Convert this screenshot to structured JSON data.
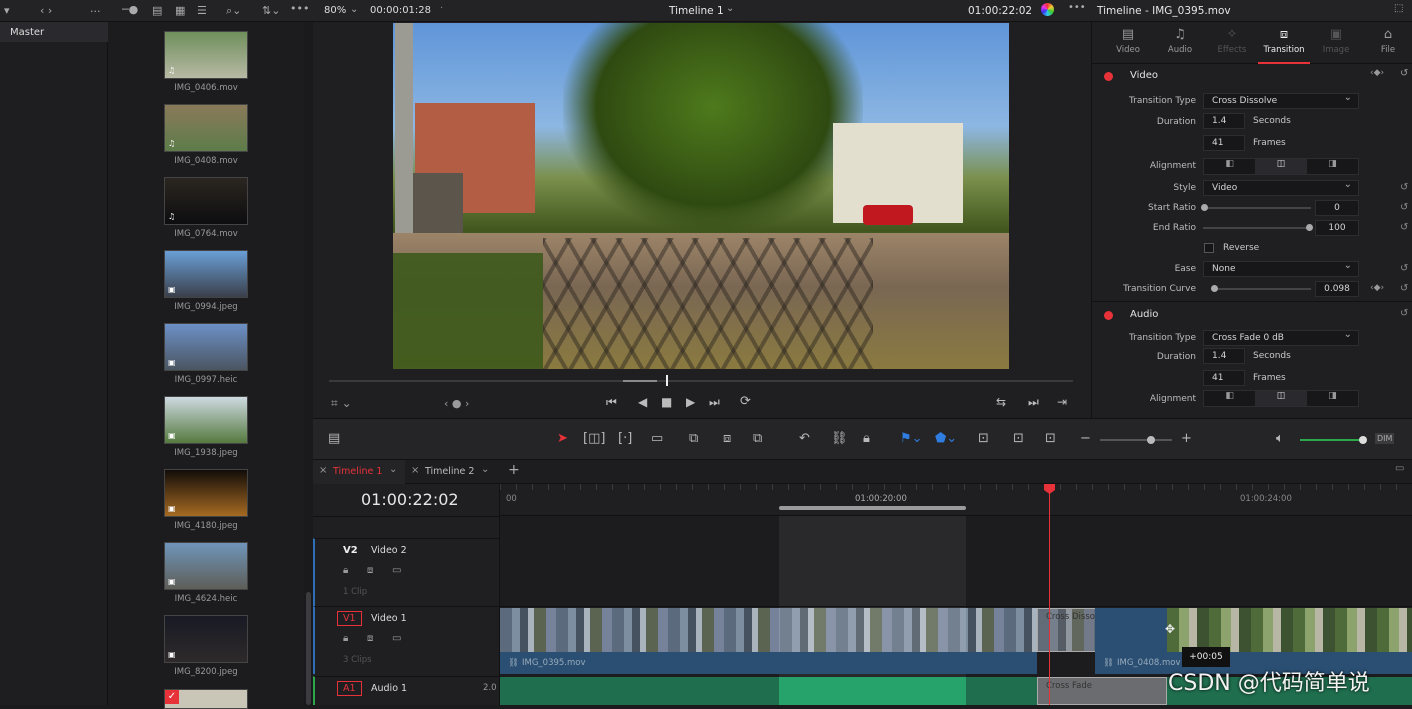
{
  "topbar": {
    "zoom": "80%",
    "zoom_timecode": "00:00:01:28",
    "timeline_name": "Timeline 1",
    "viewer_timecode": "01:00:22:02",
    "inspector_title": "Timeline - IMG_0395.mov",
    "dots": "..."
  },
  "bin": {
    "master_label": "Master"
  },
  "media": [
    {
      "name": "IMG_0406.mov",
      "type": "video",
      "colors": [
        "#6f8f5c",
        "#b7b9a4"
      ]
    },
    {
      "name": "IMG_0408.mov",
      "type": "video",
      "colors": [
        "#8a7a5a",
        "#5d7c4a"
      ]
    },
    {
      "name": "IMG_0764.mov",
      "type": "video",
      "colors": [
        "#2b2620",
        "#0d0d0f"
      ]
    },
    {
      "name": "IMG_0994.jpeg",
      "type": "image",
      "colors": [
        "#6a9fd6",
        "#3a3f4a"
      ]
    },
    {
      "name": "IMG_0997.heic",
      "type": "image",
      "colors": [
        "#6c90c6",
        "#4b5561"
      ]
    },
    {
      "name": "IMG_1938.jpeg",
      "type": "image",
      "colors": [
        "#cdd9e0",
        "#557a3f"
      ]
    },
    {
      "name": "IMG_4180.jpeg",
      "type": "image",
      "colors": [
        "#120d09",
        "#a66a22"
      ]
    },
    {
      "name": "IMG_4624.heic",
      "type": "image",
      "colors": [
        "#6f95b9",
        "#5e5e58"
      ]
    },
    {
      "name": "IMG_8200.jpeg",
      "type": "image",
      "colors": [
        "#181a24",
        "#2e2a2a"
      ]
    }
  ],
  "inspector": {
    "tabs": [
      "Video",
      "Audio",
      "Effects",
      "Transition",
      "Image",
      "File"
    ],
    "active_tab": "Transition",
    "video_section": "Video",
    "audio_section": "Audio",
    "labels": {
      "transition_type": "Transition Type",
      "duration": "Duration",
      "alignment": "Alignment",
      "style": "Style",
      "start_ratio": "Start Ratio",
      "end_ratio": "End Ratio",
      "reverse": "Reverse",
      "ease": "Ease",
      "transition_curve": "Transition Curve"
    },
    "video": {
      "transition_type": "Cross Dissolve",
      "duration_seconds": "1.4",
      "seconds_label": "Seconds",
      "duration_frames": "41",
      "frames_label": "Frames",
      "style": "Video",
      "start_ratio": "0",
      "end_ratio": "100",
      "ease": "None",
      "transition_curve": "0.098"
    },
    "audio": {
      "transition_type": "Cross Fade 0 dB",
      "duration_seconds": "1.4",
      "seconds_label": "Seconds",
      "duration_frames": "41",
      "frames_label": "Frames"
    },
    "accent": "#e8323a"
  },
  "timeline": {
    "tabs": [
      "Timeline 1",
      "Timeline 2"
    ],
    "timecode": "01:00:22:02",
    "ruler": [
      "00",
      "01:00:20:00",
      "01:00:24:00"
    ],
    "tracks": [
      {
        "id": "V2",
        "name": "Video 2",
        "clips": "1 Clip"
      },
      {
        "id": "V1",
        "name": "Video 1",
        "clips": "3 Clips"
      },
      {
        "id": "A1",
        "name": "Audio 1",
        "level": "2.0"
      }
    ],
    "clip1": "IMG_0395.mov",
    "clip2": "IMG_0408.mov",
    "video_transition": "Cross Dissolve",
    "audio_transition": "Cross Fade",
    "tooltip": "+00:05",
    "dim": "DIM"
  },
  "watermark": "CSDN @代码简单说"
}
